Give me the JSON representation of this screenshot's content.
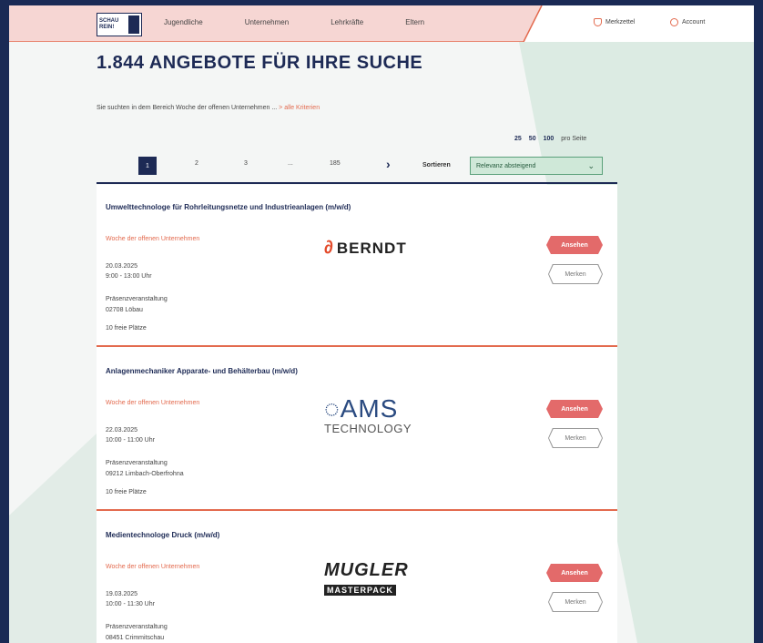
{
  "header": {
    "nav": [
      "Jugendliche",
      "Unternehmen",
      "Lehrkräfte",
      "Eltern"
    ],
    "merkzettel": "Merkzettel",
    "account": "Account"
  },
  "page_title": "1.844 ANGEBOTE FÜR IHRE SUCHE",
  "search_info": {
    "text": "Sie suchten in dem Bereich Woche der offenen Unternehmen ...",
    "link": "> alle Kriterien"
  },
  "per_page": {
    "options": [
      "25",
      "50",
      "100"
    ],
    "label": "pro Seite"
  },
  "pager": {
    "pages": [
      "1",
      "2",
      "3",
      "...",
      "185"
    ],
    "next": "›",
    "sort_label": "Sortieren",
    "sort_value": "Relevanz absteigend"
  },
  "results": [
    {
      "title": "Umwelttechnologe für Rohrleitungsnetze und Industrieanlagen (m/w/d)",
      "category": "Woche der offenen Unternehmen",
      "date": "20.03.2025",
      "time": "9:00 - 13:00 Uhr",
      "type": "Präsenzveranstaltung",
      "location": "02708 Löbau",
      "seats": "10 freie Plätze",
      "logo": "BERNDT",
      "view": "Ansehen",
      "save": "Merken"
    },
    {
      "title": "Anlagenmechaniker Apparate- und Behälterbau (m/w/d)",
      "category": "Woche der offenen Unternehmen",
      "date": "22.03.2025",
      "time": "10:00 - 11:00 Uhr",
      "type": "Präsenzveranstaltung",
      "location": "09212 Limbach-Oberfrohna",
      "seats": "10 freie Plätze",
      "logo": "AMS",
      "logo_sub": "TECHNOLOGY",
      "view": "Ansehen",
      "save": "Merken"
    },
    {
      "title": "Medientechnologe Druck (m/w/d)",
      "category": "Woche der offenen Unternehmen",
      "date": "19.03.2025",
      "time": "10:00 - 11:30 Uhr",
      "type": "Präsenzveranstaltung",
      "location": "08451 Crimmitschau",
      "logo": "MUGLER",
      "logo_sub": "MASTERPACK",
      "view": "Ansehen",
      "save": "Merken"
    }
  ]
}
